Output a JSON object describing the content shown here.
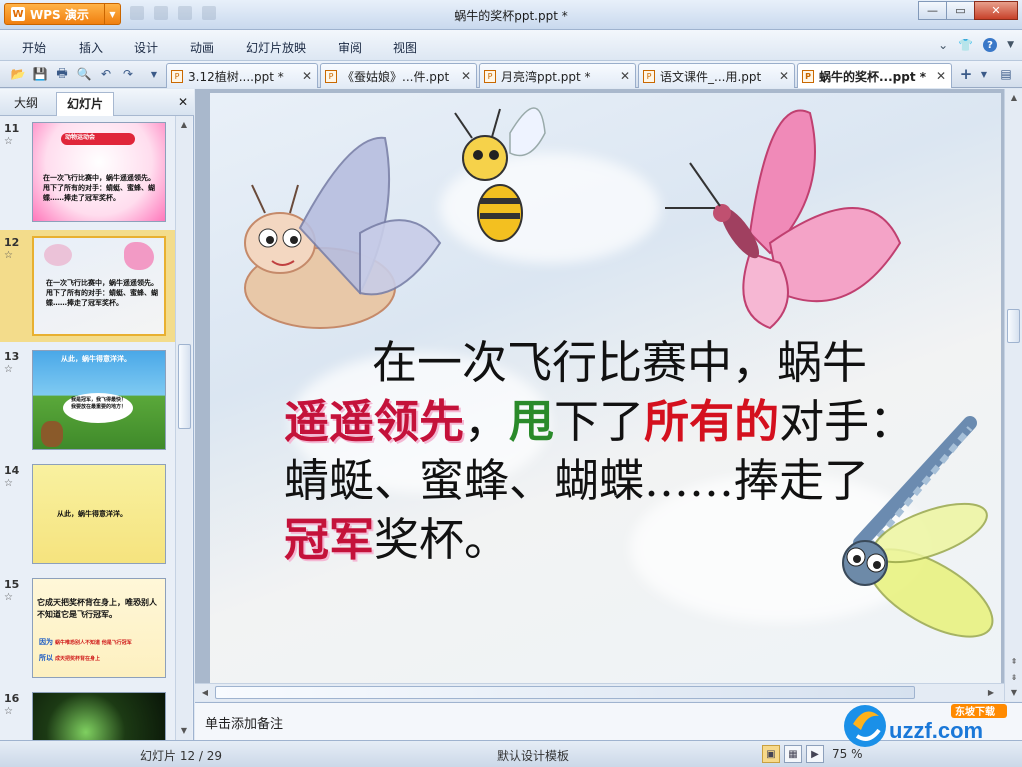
{
  "app": {
    "name": "WPS 演示",
    "document_title": "蜗牛的奖杯ppt.ppt *",
    "window_controls": [
      "minimize",
      "maximize",
      "close"
    ]
  },
  "menu": {
    "items": [
      "开始",
      "插入",
      "设计",
      "动画",
      "幻灯片放映",
      "审阅",
      "视图"
    ]
  },
  "toolbar": {
    "icons": [
      "open-icon",
      "save-icon",
      "print-icon",
      "print-preview-icon",
      "undo-icon",
      "redo-icon",
      "customize-icon"
    ]
  },
  "tabs": [
    {
      "label": "3.12植树....ppt *",
      "active": false
    },
    {
      "label": "《蚕姑娘》...件.ppt",
      "active": false
    },
    {
      "label": "月亮湾ppt.ppt *",
      "active": false
    },
    {
      "label": "语文课件_...用.ppt",
      "active": false
    },
    {
      "label": "蜗牛的奖杯...ppt *",
      "active": true
    }
  ],
  "left_panel": {
    "tabs": [
      "大纲",
      "幻灯片"
    ],
    "active_tab": "幻灯片",
    "thumbnails": [
      {
        "number": "11",
        "title": "动物运动会",
        "text": "在一次飞行比赛中，蜗牛遥遥领先。甩下了所有的对手：蜻蜓、蜜蜂、蝴蝶……捧走了冠军奖杯。"
      },
      {
        "number": "12",
        "text": "在一次飞行比赛中，蜗牛遥遥领先。甩下了所有的对手：蜻蜓、蜜蜂、蝴蝶……捧走了冠军奖杯。",
        "selected": true
      },
      {
        "number": "13",
        "text": "从此，蜗牛得意洋洋。",
        "extra": "我是冠军，我飞得最快！我要放在最重要的地方！"
      },
      {
        "number": "14",
        "text": "从此，蜗牛得意洋洋。"
      },
      {
        "number": "15",
        "text": "它成天把奖杯背在身上，唯恐别人不知道它是飞行冠军。",
        "extra1": "因为",
        "extra2": "所以",
        "fill1": "蜗牛唯恐别人不知道 他是飞行冠军",
        "fill2": "成天把奖杯背在身上"
      },
      {
        "number": "16",
        "text": ""
      }
    ]
  },
  "slide": {
    "line1": "在一次飞行比赛中，蜗牛",
    "line2_a": "遥遥领先",
    "line2_b": "，",
    "line2_c": "甩",
    "line2_d": "下了",
    "line2_e": "所有的",
    "line2_f": "对手：",
    "line3": "蜻蜓、蜜蜂、蝴蝶……捧走了",
    "line4_a": "冠军",
    "line4_b": "奖杯。"
  },
  "notes": {
    "placeholder": "单击添加备注"
  },
  "status": {
    "slide_info": "幻灯片 12 / 29",
    "template": "默认设计模板",
    "zoom": "75 %"
  },
  "watermark": {
    "brand": "uzzf.com",
    "tag": "东坡下载"
  }
}
